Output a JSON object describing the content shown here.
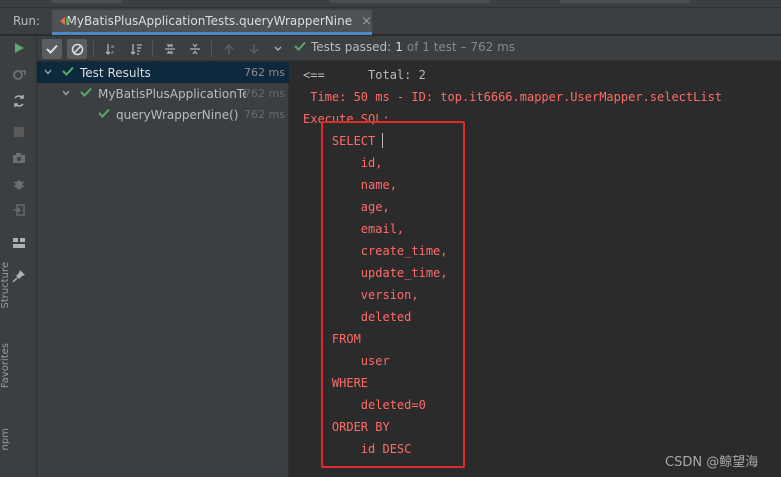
{
  "run_bar": {
    "label": "Run:",
    "tab_title": "MyBatisPlusApplicationTests.queryWrapperNine",
    "close": "×"
  },
  "toolbar": {
    "status_label": "Tests passed:",
    "status_count": "1",
    "status_rest": "of 1 test – 762 ms"
  },
  "tree": {
    "rows": [
      {
        "name": "Test Results",
        "time": "762 ms"
      },
      {
        "name": "MyBatisPlusApplicationTe",
        "time": "762 ms"
      },
      {
        "name": "queryWrapperNine()",
        "time": "762 ms"
      }
    ]
  },
  "console": {
    "lines": [
      "<==      Total: 2",
      " Time: 50 ms - ID: top.it6666.mapper.UserMapper.selectList",
      "Execute SQL:",
      "    SELECT",
      "        id,",
      "        name,",
      "        age,",
      "        email,",
      "        create_time,",
      "        update_time,",
      "        version,",
      "        deleted",
      "    FROM",
      "        user",
      "    WHERE",
      "        deleted=0",
      "    ORDER BY",
      "        id DESC"
    ]
  },
  "side_labels": [
    "Structure",
    "Favorites",
    "npm"
  ],
  "watermark": "CSDN @鲸望海",
  "colors": {
    "accent": "#4a88c7",
    "pass_green": "#59a869",
    "sql_red": "#ff6b68",
    "box_red": "#e22a2a"
  }
}
